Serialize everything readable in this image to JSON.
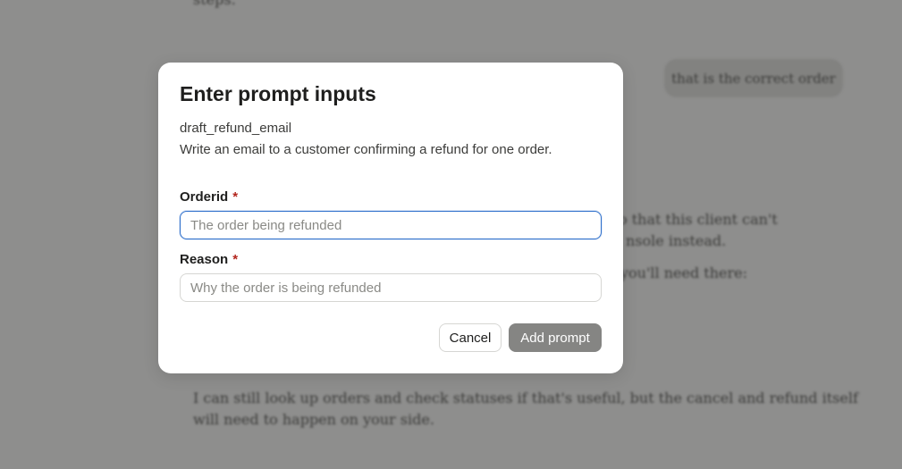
{
  "background_chat": {
    "line_top_fragment": "steps.",
    "user_bubble": "that is the correct order",
    "line_1": "o that this client can't",
    "line_2": "nsole instead.",
    "line_3": "you'll need there:",
    "para_line_1": "I can still look up orders and check statuses if that's useful, but the cancel and refund itself",
    "para_line_2": "will need to happen on your side."
  },
  "modal": {
    "title": "Enter prompt inputs",
    "prompt_name": "draft_refund_email",
    "prompt_description": "Write an email to a customer confirming a refund for one order.",
    "fields": [
      {
        "label": "Orderid",
        "required_mark": "*",
        "value": "",
        "placeholder": "The order being refunded",
        "focused": true
      },
      {
        "label": "Reason",
        "required_mark": "*",
        "value": "",
        "placeholder": "Why the order is being refunded",
        "focused": false
      }
    ],
    "buttons": {
      "cancel_label": "Cancel",
      "add_label": "Add prompt"
    }
  },
  "colors": {
    "overlay": "#8e8e8d",
    "focus_ring": "#2c6ecb",
    "required": "#b3261e",
    "add_button_disabled": "#858583"
  }
}
